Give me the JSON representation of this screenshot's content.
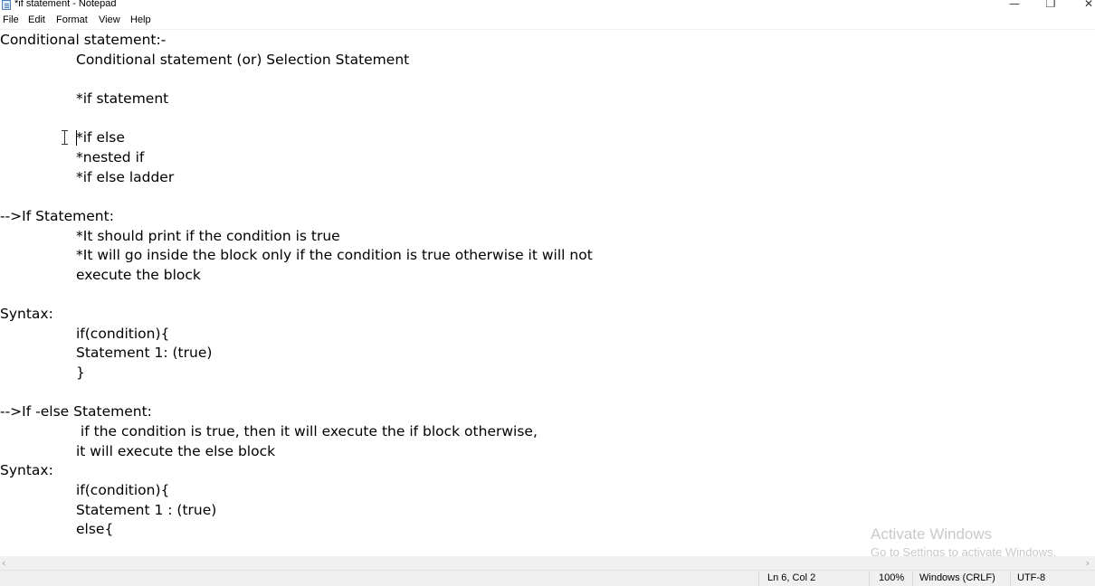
{
  "window": {
    "title": "*if statement - Notepad",
    "minimize_glyph": "—",
    "maximize_glyph": "❐",
    "close_glyph": "✕"
  },
  "menu": {
    "file": "File",
    "edit": "Edit",
    "format": "Format",
    "view": "View",
    "help": "Help"
  },
  "editor": {
    "lines": [
      "Conditional statement:-",
      "Conditional statement (or) Selection Statement",
      "*if statement",
      "*if else",
      "*nested if",
      "*if else ladder",
      "-->If Statement:",
      "*It should print if the condition is true",
      "*It will go inside the block only if the condition is true otherwise it will not",
      "execute the block",
      "Syntax:",
      "if(condition){",
      "Statement 1: (true)",
      "}",
      "-->If -else Statement:",
      " if the condition is true, then it will execute the if block otherwise,",
      "it will execute the else block",
      "Syntax:",
      "if(condition){",
      "Statement 1 : (true)",
      "else{"
    ]
  },
  "watermark": {
    "line1": "Activate Windows",
    "line2": "Go to Settings to activate Windows."
  },
  "scrollbar": {
    "left_arrow": "‹",
    "right_arrow": "›"
  },
  "status": {
    "position": "Ln 6, Col 2",
    "zoom": "100%",
    "line_ending": "Windows (CRLF)",
    "encoding": "UTF-8"
  }
}
